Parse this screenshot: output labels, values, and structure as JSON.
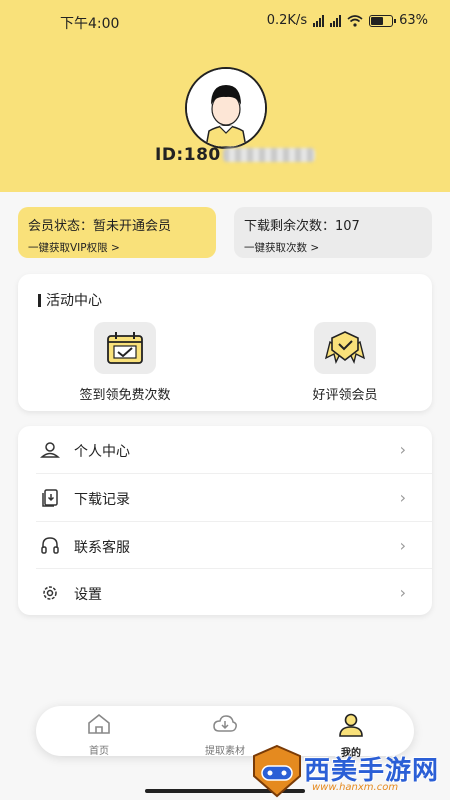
{
  "status_bar": {
    "time": "下午4:00",
    "network_speed": "0.2K/s",
    "battery": "63%",
    "battery_level": 0.63
  },
  "profile": {
    "id_prefix": "ID:180"
  },
  "membership_card": {
    "title": "会员状态：暂未开通会员",
    "action": "一键获取VIP权限 >"
  },
  "download_card": {
    "title": "下载剩余次数：107",
    "action": "一键获取次数 >"
  },
  "activity_center": {
    "title": "活动中心",
    "items": [
      {
        "label": "签到领免费次数",
        "icon": "calendar-check-icon"
      },
      {
        "label": "好评领会员",
        "icon": "badge-check-icon"
      }
    ]
  },
  "menu": {
    "items": [
      {
        "label": "个人中心",
        "icon": "user-card-icon"
      },
      {
        "label": "下载记录",
        "icon": "download-record-icon"
      },
      {
        "label": "联系客服",
        "icon": "headset-icon"
      },
      {
        "label": "设置",
        "icon": "gear-icon"
      }
    ]
  },
  "tabbar": {
    "items": [
      {
        "label": "首页",
        "icon": "home-icon"
      },
      {
        "label": "提取素材",
        "icon": "extract-icon"
      },
      {
        "label": "我的",
        "icon": "profile-icon",
        "active": true
      }
    ]
  },
  "watermark": {
    "name": "西美手游网",
    "url": "www.hanxm.com"
  },
  "colors": {
    "accent": "#f9e17a",
    "card_gray": "#ebebeb",
    "text": "#222222"
  }
}
